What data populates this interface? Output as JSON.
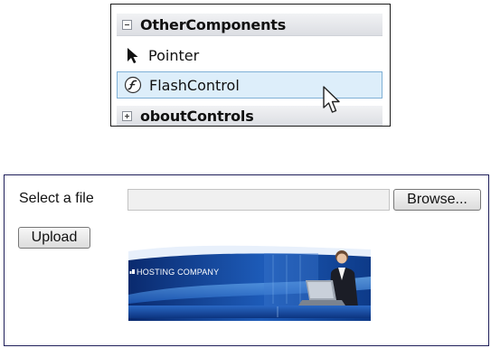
{
  "toolbox": {
    "groups": [
      {
        "label": "OtherComponents",
        "expanded": true,
        "toggle_icon": "minus-box-icon"
      },
      {
        "label": "oboutControls",
        "expanded": false,
        "toggle_icon": "plus-box-icon"
      }
    ],
    "items": [
      {
        "label": "Pointer",
        "icon": "pointer-arrow-icon",
        "selected": false
      },
      {
        "label": "FlashControl",
        "icon": "flash-icon",
        "selected": true
      }
    ],
    "cursor_icon": "mouse-cursor-icon",
    "colors": {
      "selection_fill": "#ddeefa",
      "selection_border": "#7fb0d6",
      "header_fill": "#e3e5e9"
    }
  },
  "upload_form": {
    "file_label": "Select a file",
    "file_value": "",
    "browse_label": "Browse...",
    "upload_label": "Upload",
    "banner": {
      "brand": "HOSTING COMPANY",
      "tagline": "",
      "nav_items": [
        "",
        "",
        "",
        "",
        "",
        ""
      ]
    },
    "colors": {
      "border": "#1f1f5a",
      "banner_dark": "#0b2f7a",
      "banner_light": "#2f7fd6"
    }
  }
}
